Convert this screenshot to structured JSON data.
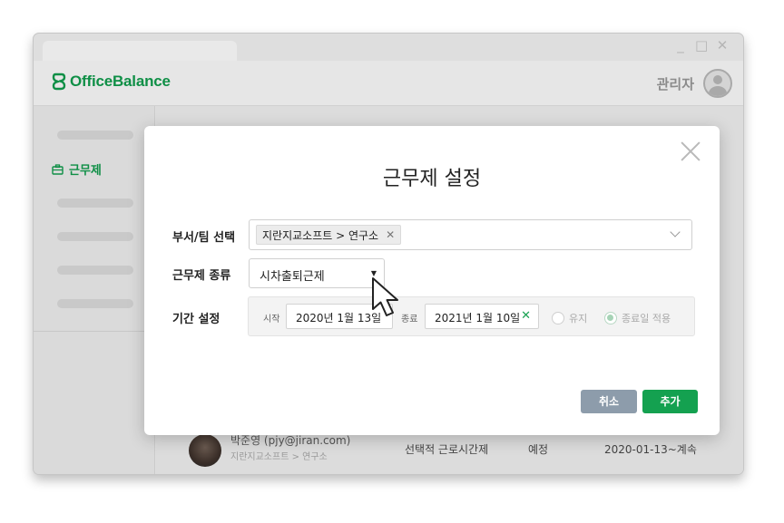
{
  "app": {
    "brand": "OfficeBalance",
    "brand_color": "#0f8f46",
    "window_controls": [
      "_",
      "□",
      "✕"
    ],
    "user_name": "관리자"
  },
  "sidebar": {
    "active_item": "근무제"
  },
  "background_row": {
    "name": "박준영 (pjy@jiran.com)",
    "dept": "지란지교소프트 > 연구소",
    "type": "선택적 근로시간제",
    "status": "예정",
    "period": "2020-01-13~계속"
  },
  "modal": {
    "title": "근무제 설정",
    "dept_label": "부서/팀 선택",
    "dept_selected": "지란지교소프트 > 연구소",
    "chip_remove": "✕",
    "type_label": "근무제 종류",
    "type_value": "시차출퇴근제",
    "type_caret": "▼",
    "period_label": "기간 설정",
    "start_label": "시작",
    "start_date": "2020년 1월 13일",
    "end_label": "종료",
    "end_date": "2021년 1월 10일",
    "end_clear": "✕",
    "radio_keep": "유지",
    "radio_end": "종료일 적용",
    "cancel": "취소",
    "add": "추가"
  },
  "colors": {
    "primary": "#14a150",
    "cancel": "#8d9cab"
  }
}
